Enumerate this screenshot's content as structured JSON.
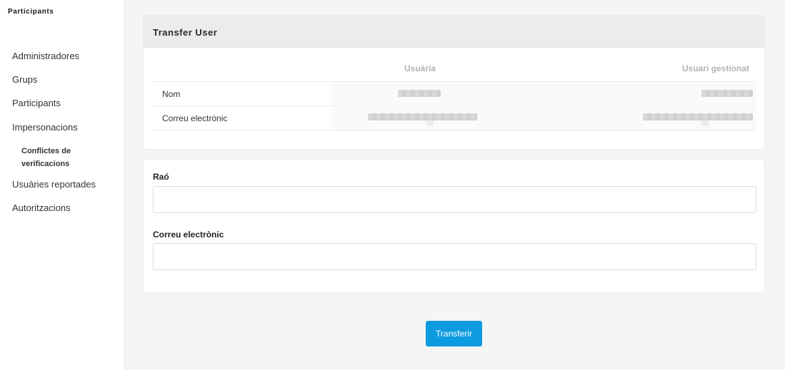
{
  "sidebar": {
    "title": "Participants",
    "items": [
      {
        "label": "Administradores"
      },
      {
        "label": "Grups"
      },
      {
        "label": "Participants"
      },
      {
        "label": "Impersonacions"
      },
      {
        "label": "Conflictes de verificacions"
      },
      {
        "label": "Usuàries reportades"
      },
      {
        "label": "Autoritzacions"
      }
    ]
  },
  "transfer_card": {
    "title": "Transfer User",
    "columns": {
      "user": "Usuària",
      "managed_user": "Usuari gestionat"
    },
    "rows": [
      {
        "label": "Nom"
      },
      {
        "label": "Correu electrònic"
      }
    ]
  },
  "form": {
    "reason_label": "Raó",
    "reason_value": "",
    "email_label": "Correu electrònic",
    "email_value": ""
  },
  "actions": {
    "transfer_label": "Transferir"
  },
  "colors": {
    "accent": "#0d9be0",
    "sidebar_bg": "#ffffff",
    "page_bg": "#f5f5f5"
  }
}
